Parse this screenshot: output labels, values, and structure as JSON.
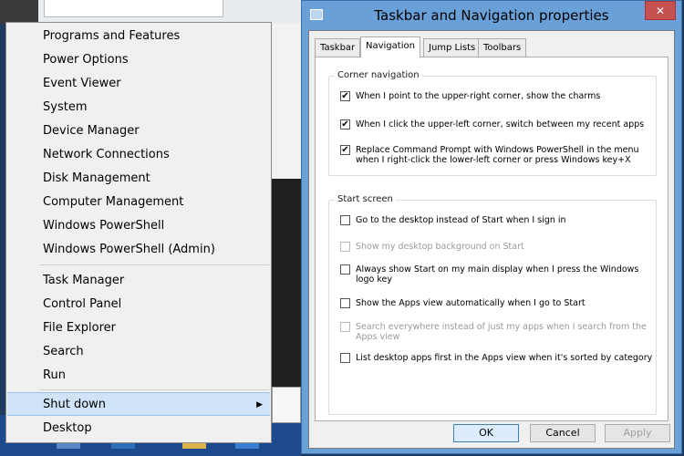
{
  "winx_menu": {
    "items": [
      "Programs and Features",
      "Power Options",
      "Event Viewer",
      "System",
      "Device Manager",
      "Network Connections",
      "Disk Management",
      "Computer Management",
      "Windows PowerShell",
      "Windows PowerShell (Admin)",
      "Task Manager",
      "Control Panel",
      "File Explorer",
      "Search",
      "Run",
      "Shut down",
      "Desktop"
    ],
    "highlighted": "Shut down"
  },
  "dialog": {
    "title": "Taskbar and Navigation properties",
    "close_label": "✕",
    "tabs": [
      "Taskbar",
      "Navigation",
      "Jump Lists",
      "Toolbars"
    ],
    "active_tab": "Navigation",
    "corner_navigation": {
      "label": "Corner navigation",
      "options": [
        {
          "label": "When I point to the upper-right corner, show the charms",
          "checked": true,
          "enabled": true
        },
        {
          "label": "When I click the upper-left corner, switch between my recent apps",
          "checked": true,
          "enabled": true
        },
        {
          "label": "Replace Command Prompt with Windows PowerShell in the menu when I right-click the lower-left corner or press Windows key+X",
          "checked": true,
          "enabled": true
        }
      ]
    },
    "start_screen": {
      "label": "Start screen",
      "options": [
        {
          "label": "Go to the desktop instead of Start when I sign in",
          "checked": false,
          "enabled": true
        },
        {
          "label": "Show my desktop background on Start",
          "checked": false,
          "enabled": false
        },
        {
          "label": "Always show Start on my main display when I press the Windows logo key",
          "checked": false,
          "enabled": true
        },
        {
          "label": "Show the Apps view automatically when I go to Start",
          "checked": false,
          "enabled": true
        },
        {
          "label": "Search everywhere instead of just my apps when I search from the Apps view",
          "checked": false,
          "enabled": false
        },
        {
          "label": "List desktop apps first in the Apps view when it's sorted by category",
          "checked": false,
          "enabled": true
        }
      ]
    },
    "buttons": {
      "ok": "OK",
      "cancel": "Cancel",
      "apply": "Apply"
    }
  },
  "icons": {
    "submenu_arrow": "chevron-right-icon",
    "checkmark": "check-icon"
  }
}
